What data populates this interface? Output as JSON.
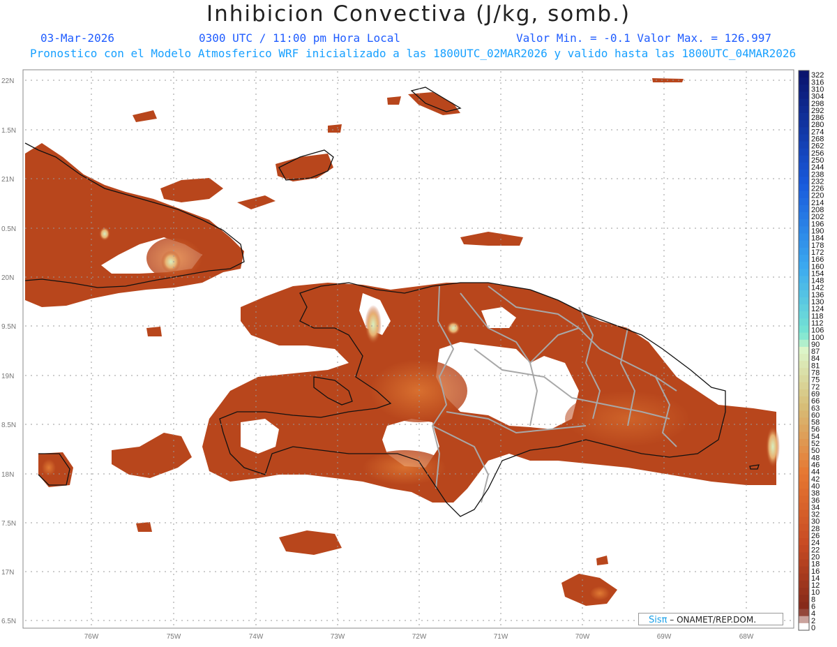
{
  "title": "Inhibicion Convectiva (J/kg, somb.)",
  "header": {
    "date": "03-Mar-2026",
    "time": "0300 UTC / 11:00 pm Hora Local",
    "minmax": "Valor Min. = -0.1  Valor Max. = 126.997",
    "subtitle": "Pronostico con el Modelo Atmosferico WRF inicializado a las 1800UTC_02MAR2026 y valido hasta las  1800UTC_04MAR2026"
  },
  "lat_labels": [
    "22N",
    "1.5N",
    "21N",
    "0.5N",
    "20N",
    "9.5N",
    "19N",
    "8.5N",
    "18N",
    "7.5N",
    "17N",
    "6.5N"
  ],
  "lon_labels": [
    "76W",
    "75W",
    "74W",
    "73W",
    "72W",
    "71W",
    "70W",
    "69W",
    "68W"
  ],
  "colorbar": {
    "labels": [
      "322",
      "316",
      "310",
      "304",
      "298",
      "292",
      "286",
      "280",
      "274",
      "268",
      "262",
      "256",
      "250",
      "244",
      "238",
      "232",
      "226",
      "220",
      "214",
      "208",
      "202",
      "196",
      "190",
      "184",
      "178",
      "172",
      "166",
      "160",
      "154",
      "148",
      "142",
      "136",
      "130",
      "124",
      "118",
      "112",
      "106",
      "100",
      "90",
      "87",
      "84",
      "81",
      "78",
      "75",
      "72",
      "69",
      "66",
      "63",
      "60",
      "58",
      "56",
      "54",
      "52",
      "50",
      "48",
      "46",
      "44",
      "42",
      "40",
      "38",
      "36",
      "34",
      "32",
      "30",
      "28",
      "26",
      "24",
      "22",
      "20",
      "18",
      "16",
      "14",
      "12",
      "10",
      "8",
      "6",
      "4",
      "2",
      "0"
    ]
  },
  "colors": {
    "field_main": "#b8461c",
    "field_dark": "#8e2f16",
    "field_light": "#d9662a",
    "field_peak": "#c8e8b0",
    "coastline": "#111111",
    "provinces": "#a8a8a8",
    "grid": "#9a9a9a"
  },
  "credit": {
    "brand": "Sisπ",
    "text": "– ONAMET/REP.DOM."
  }
}
